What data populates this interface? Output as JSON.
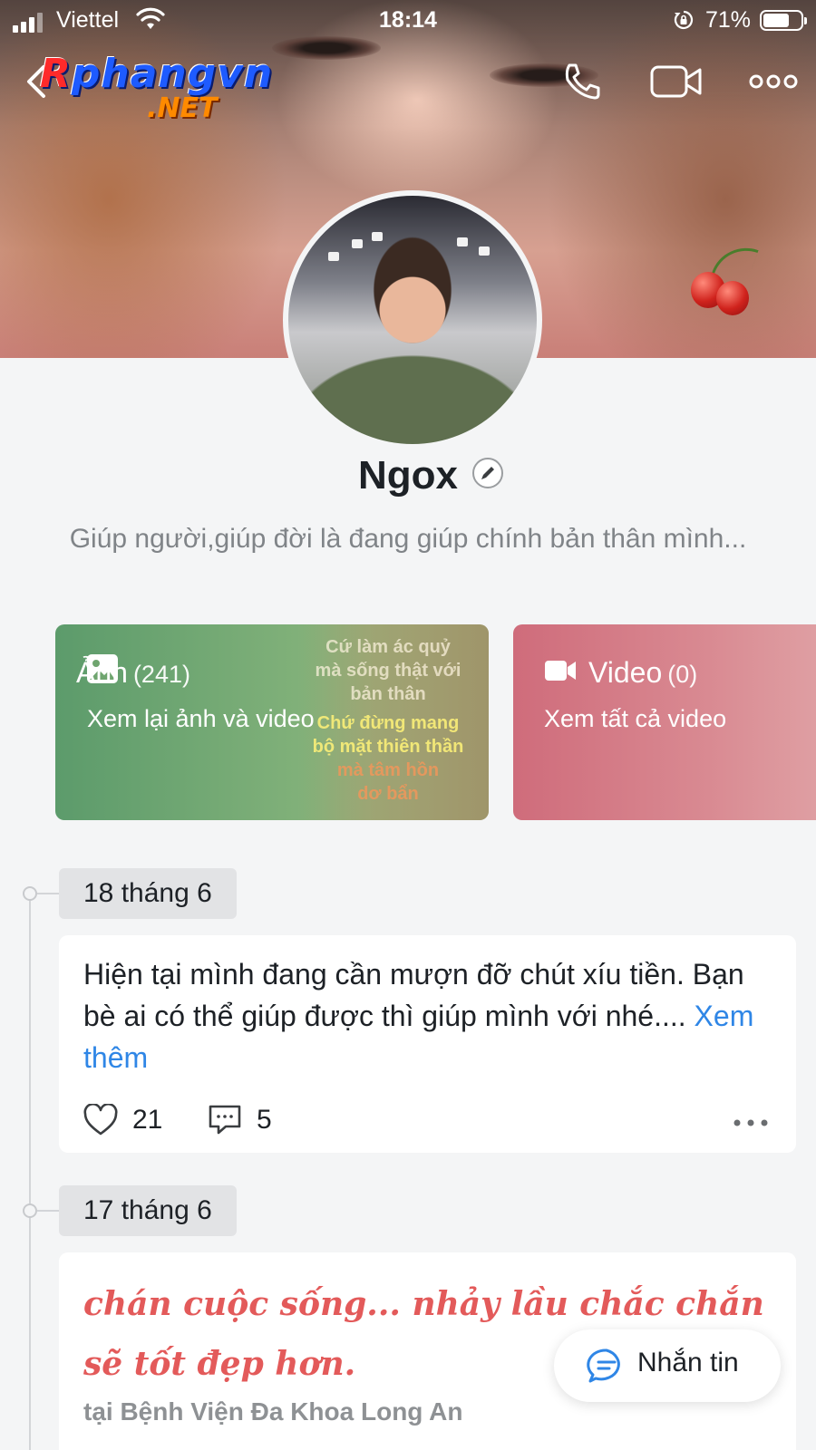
{
  "status_bar": {
    "carrier": "Viettel",
    "time": "18:14",
    "battery_pct": "71%",
    "battery_level": 0.71
  },
  "nav": {
    "watermark_main": "Rphangvn",
    "watermark_sub": ".NET",
    "icons": [
      "back-icon",
      "phone-icon",
      "video-call-icon",
      "more-icon"
    ]
  },
  "profile": {
    "name": "Ngox",
    "bio": "Giúp người,giúp đời là đang giúp chính bản thân mình..."
  },
  "media": {
    "photos": {
      "title": "Ảnh",
      "count": "(241)",
      "subtitle": "Xem lại ảnh và video",
      "thumb_lines": [
        "Cứ làm ác quỷ",
        "mà sống thật với",
        "bản thân",
        "Chứ đừng mang",
        "bộ mặt thiên thần",
        "mà tâm hồn",
        "dơ bẩn"
      ]
    },
    "videos": {
      "title": "Video",
      "count": "(0)",
      "subtitle": "Xem tất cả video"
    }
  },
  "timeline": [
    {
      "date": "18 tháng 6",
      "text": "Hiện tại mình đang cần mượn đỡ chút xíu tiền. Bạn bè ai có thể giúp được thì giúp mình với nhé....",
      "more_label": "Xem thêm",
      "likes": "21",
      "comments": "5"
    },
    {
      "date": "17 tháng 6",
      "text": "chán cuộc sống... nhảy lầu chắc chắn sẽ tốt đẹp hơn.",
      "place": "tại Bệnh Viện Đa Khoa Long An"
    }
  ],
  "message_button": {
    "label": "Nhắn tin"
  },
  "colors": {
    "accent_blue": "#2f86e6",
    "photo_card": "#6fa56f",
    "video_card": "#d47a86",
    "status_red": "#e35a5a"
  }
}
